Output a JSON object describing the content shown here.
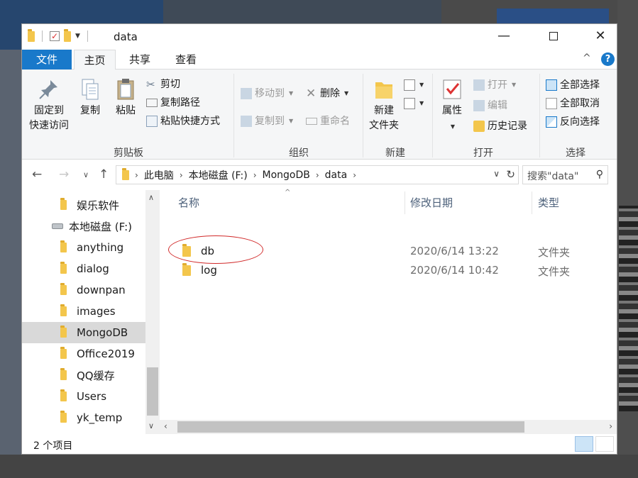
{
  "window": {
    "title": "data",
    "min_glyph": "—",
    "close_glyph": "✕"
  },
  "ribbon_tabs": {
    "file": "文件",
    "home": "主页",
    "share": "共享",
    "view": "查看",
    "help": "?"
  },
  "clipboard": {
    "pin": "固定到",
    "pin2": "快速访问",
    "copy": "复制",
    "paste": "粘贴",
    "cut": "剪切",
    "copy_path": "复制路径",
    "paste_shortcut": "粘贴快捷方式",
    "label": "剪贴板"
  },
  "organize": {
    "move_to": "移动到",
    "copy_to": "复制到",
    "delete": "删除",
    "rename": "重命名",
    "label": "组织"
  },
  "new": {
    "new_folder1": "新建",
    "new_folder2": "文件夹",
    "label": "新建"
  },
  "open": {
    "properties": "属性",
    "open": "打开",
    "edit": "编辑",
    "history": "历史记录",
    "label": "打开"
  },
  "select": {
    "select_all": "全部选择",
    "select_none": "全部取消",
    "invert": "反向选择",
    "label": "选择"
  },
  "address": {
    "crumbs": [
      "此电脑",
      "本地磁盘 (F:)",
      "MongoDB",
      "data"
    ],
    "search_placeholder": "搜索\"data\""
  },
  "nav_pane": {
    "items": [
      {
        "label": "娱乐软件",
        "type": "folder"
      },
      {
        "label": "本地磁盘 (F:)",
        "type": "drive"
      },
      {
        "label": "anything",
        "type": "folder"
      },
      {
        "label": "dialog",
        "type": "folder"
      },
      {
        "label": "downpan",
        "type": "folder"
      },
      {
        "label": "images",
        "type": "folder"
      },
      {
        "label": "MongoDB",
        "type": "folder",
        "selected": true
      },
      {
        "label": "Office2019",
        "type": "folder"
      },
      {
        "label": "QQ缓存",
        "type": "folder"
      },
      {
        "label": "Users",
        "type": "folder"
      },
      {
        "label": "yk_temp",
        "type": "folder"
      }
    ]
  },
  "file_list": {
    "columns": {
      "name": "名称",
      "date": "修改日期",
      "type": "类型"
    },
    "rows": [
      {
        "name": "db",
        "date": "2020/6/14 13:22",
        "type": "文件夹"
      },
      {
        "name": "log",
        "date": "2020/6/14 10:42",
        "type": "文件夹"
      }
    ]
  },
  "status": {
    "count": "2 个项目"
  },
  "colors": {
    "accent": "#1979ca",
    "folder": "#f3c64c",
    "annotation": "#d12a2a",
    "selected_bg": "#d9d9d9"
  }
}
